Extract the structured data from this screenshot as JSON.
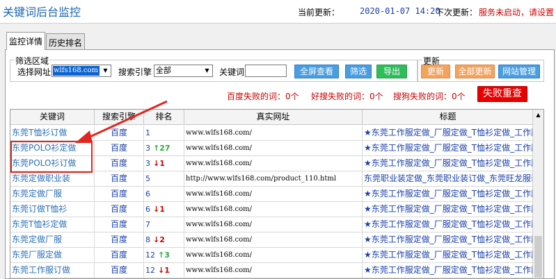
{
  "app_title": "关键词后台监控",
  "header": {
    "current_update_label": "当前更新：",
    "current_update_time": "2020-01-07 14:20",
    "next_update_label": "下次更新：",
    "service_status": "服务未启动，请设置"
  },
  "tabs": [
    {
      "label": "监控详情",
      "active": true
    },
    {
      "label": "历史排名",
      "active": false
    }
  ],
  "filter": {
    "group_title": "筛选区域",
    "site_label": "选择网址",
    "site_value": "wlfs168.com",
    "engine_label": "搜索引擎",
    "engine_value": "全部",
    "keyword_label": "关键词",
    "keyword_value": "",
    "fullscreen_button": "全屏查看",
    "filter_button": "筛选",
    "export_button": "导出"
  },
  "update_group": {
    "group_title": "更新",
    "update_button": "更新",
    "update_all_button": "全部更新",
    "site_manage_button": "网站管理"
  },
  "fail_stats": {
    "baidu": "百度失败的词：0个",
    "haosou": "好搜失败的词：0个",
    "sogou": "搜狗失败的词：0个",
    "retry_button": "失败重查"
  },
  "table": {
    "columns": [
      "关键词",
      "搜索引擎",
      "排名",
      "真实网址",
      "标题"
    ],
    "rows": [
      {
        "keyword": "东莞T恤衫订做",
        "engine": "百度",
        "rank": "1",
        "change": "",
        "dir": "",
        "url": "www.wlfs168.com/",
        "title": "★东莞工作服定做_厂服定做_T恤衫定做_工作服..."
      },
      {
        "keyword": "东莞POLO衫定做",
        "engine": "百度",
        "rank": "3",
        "change": "27",
        "dir": "up",
        "url": "www.wlfs168.com/",
        "title": "★东莞工作服定做_厂服定做_T恤衫定做_工作服..."
      },
      {
        "keyword": "东莞POLO衫订做",
        "engine": "百度",
        "rank": "3",
        "change": "1",
        "dir": "down",
        "url": "www.wlfs168.com/",
        "title": "★东莞工作服定做_厂服定做_T恤衫定做_工作服..."
      },
      {
        "keyword": "东莞定做职业装",
        "engine": "百度",
        "rank": "5",
        "change": "",
        "dir": "",
        "url": "http://www.wlfs168.com/product_110.html",
        "title": "东莞职业装定做_东莞职业装订做_东莞旺龙服装..."
      },
      {
        "keyword": "东莞定做厂服",
        "engine": "百度",
        "rank": "6",
        "change": "",
        "dir": "",
        "url": "www.wlfs168.com/",
        "title": "★东莞工作服定做_厂服定做_T恤衫定做_工作服..."
      },
      {
        "keyword": "东莞订做T恤衫",
        "engine": "百度",
        "rank": "6",
        "change": "1",
        "dir": "down",
        "url": "www.wlfs168.com/",
        "title": "★东莞工作服定做_厂服定做_T恤衫定做_工作服..."
      },
      {
        "keyword": "东莞T恤衫定做",
        "engine": "百度",
        "rank": "7",
        "change": "",
        "dir": "",
        "url": "www.wlfs168.com/",
        "title": "★东莞工作服定做_厂服定做_T恤衫定做_工作服..."
      },
      {
        "keyword": "东莞定做厂服",
        "engine": "百度",
        "rank": "8",
        "change": "2",
        "dir": "down",
        "url": "www.wlfs168.com/",
        "title": "★东莞工作服定做_厂服定做_T恤衫定做_工作服..."
      },
      {
        "keyword": "东莞厂服定做",
        "engine": "百度",
        "rank": "12",
        "change": "3",
        "dir": "up",
        "url": "www.wlfs168.com/",
        "title": "★东莞工作服定做_厂服定做_T恤衫定做_工作服..."
      },
      {
        "keyword": "东莞工作服订做",
        "engine": "百度",
        "rank": "12",
        "change": "1",
        "dir": "down",
        "url": "www.wlfs168.com/",
        "title": "★东莞工作服定做_厂服定做_T恤衫定做_工作服..."
      }
    ]
  },
  "colors": {
    "accent_blue": "#1a66b3",
    "error_red": "#d00000",
    "up_green": "#2caa3a",
    "highlight_red": "#e0261e"
  }
}
